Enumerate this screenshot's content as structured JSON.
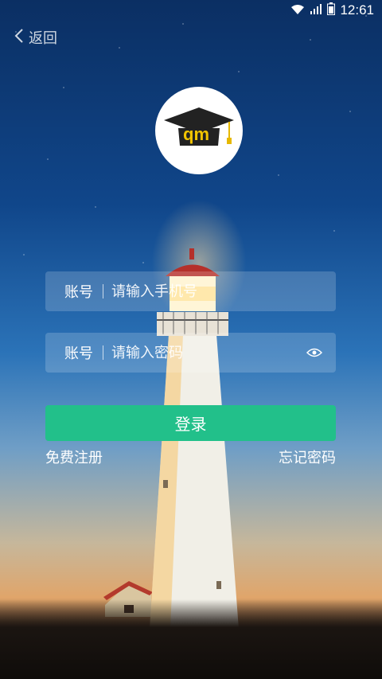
{
  "status_bar": {
    "time": "12:61",
    "icons": [
      "wifi-icon",
      "signal-icon",
      "battery-icon"
    ]
  },
  "nav": {
    "back_label": "返回",
    "back_icon": "chevron-left-icon"
  },
  "logo": {
    "text": "qm",
    "icon": "graduation-cap-icon"
  },
  "form": {
    "account": {
      "label": "账号",
      "placeholder": "请输入手机号"
    },
    "password": {
      "label": "账号",
      "placeholder": "请输入密码",
      "toggle_icon": "eye-icon"
    },
    "login_label": "登录",
    "register_label": "免费注册",
    "forgot_label": "忘记密码"
  },
  "colors": {
    "primary": "#22c08a",
    "field_bg": "rgba(255,255,255,0.18)",
    "text": "#ffffff"
  }
}
